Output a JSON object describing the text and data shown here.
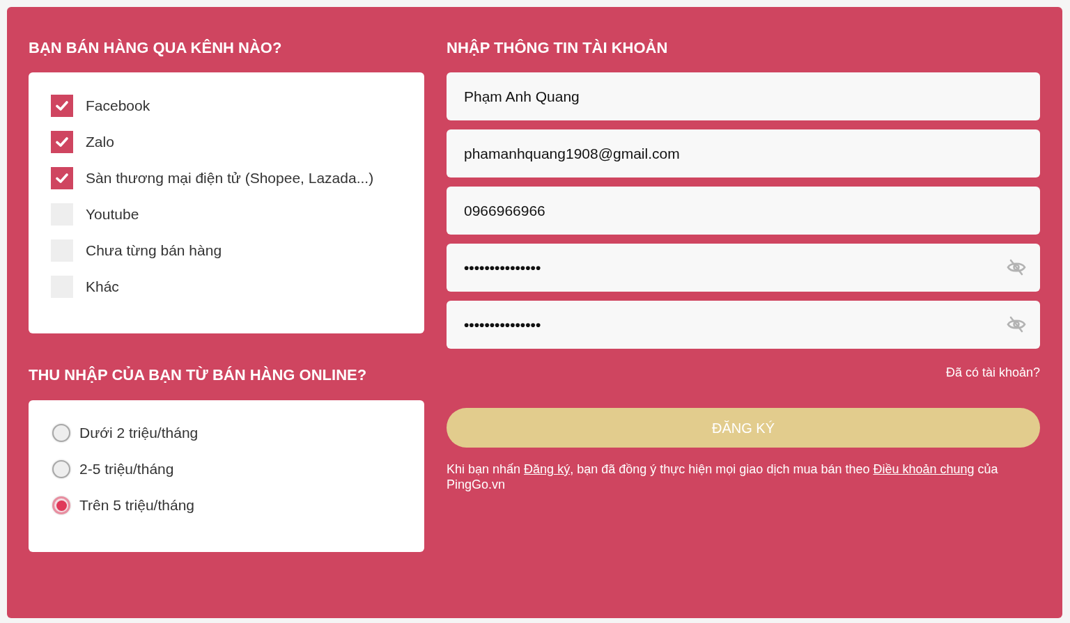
{
  "channels_section": {
    "title": "BẠN BÁN HÀNG QUA KÊNH NÀO?",
    "options": [
      {
        "label": "Facebook",
        "checked": true
      },
      {
        "label": "Zalo",
        "checked": true
      },
      {
        "label": "Sàn thương mại điện tử (Shopee, Lazada...)",
        "checked": true
      },
      {
        "label": "Youtube",
        "checked": false
      },
      {
        "label": "Chưa từng bán hàng",
        "checked": false
      },
      {
        "label": "Khác",
        "checked": false
      }
    ]
  },
  "income_section": {
    "title": "THU NHẬP CỦA BẠN TỪ BÁN HÀNG ONLINE?",
    "options": [
      {
        "label": "Dưới 2 triệu/tháng",
        "selected": false
      },
      {
        "label": "2-5 triệu/tháng",
        "selected": false
      },
      {
        "label": "Trên 5 triệu/tháng",
        "selected": true
      }
    ]
  },
  "account_section": {
    "title": "NHẬP THÔNG TIN TÀI KHOẢN",
    "fields": [
      {
        "kind": "text",
        "value": "Phạm Anh Quang"
      },
      {
        "kind": "text",
        "value": "phamanhquang1908@gmail.com"
      },
      {
        "kind": "text",
        "value": "0966966966"
      },
      {
        "kind": "password",
        "value": "•••••••••••••••"
      },
      {
        "kind": "password",
        "value": "•••••••••••••••"
      }
    ],
    "login_link": "Đã có tài khoản?",
    "submit_button": "ĐĂNG KÝ",
    "terms": [
      {
        "kind": "text",
        "text": "Khi bạn nhấn "
      },
      {
        "kind": "link",
        "text": "Đăng ký"
      },
      {
        "kind": "text",
        "text": ", bạn đã đồng ý thực hiện mọi giao dịch mua bán theo "
      },
      {
        "kind": "link",
        "text": "Điều khoản chung"
      },
      {
        "kind": "text",
        "text": " của PingGo.vn"
      }
    ]
  }
}
